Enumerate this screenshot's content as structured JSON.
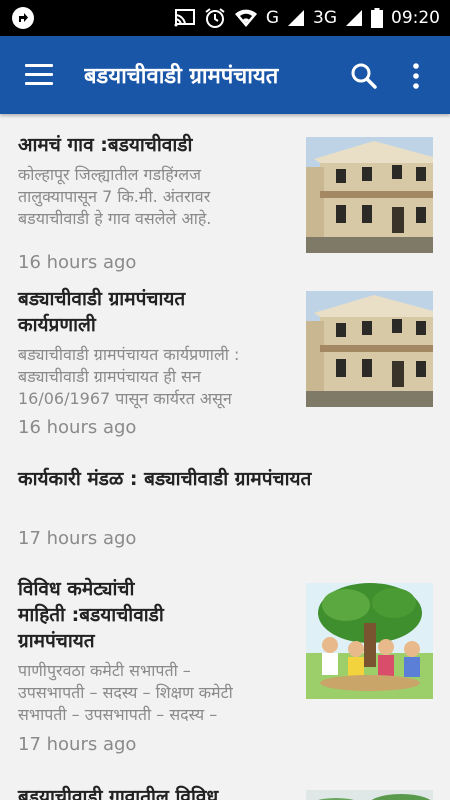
{
  "status_bar": {
    "network_label": "G",
    "network2_label": "3G",
    "time": "09:20",
    "icons": [
      "app-notification-icon",
      "cast-icon",
      "alarm-icon",
      "wifi-icon",
      "signal-icon",
      "signal-icon",
      "battery-icon"
    ]
  },
  "app_bar": {
    "title": "बडयाचीवाडी ग्रामपंचायत",
    "icons": [
      "menu-icon",
      "search-icon",
      "more-vert-icon"
    ],
    "color": "#1a56a8"
  },
  "posts": [
    {
      "title": "आमचं गाव :बडयाचीवाडी",
      "excerpt_lines": [
        "कोल्हापूर जिल्ह्यातील गडहिंग्लज",
        "तालुक्यापासून 7  कि.मी. अंतरावर",
        "बडयाचीवाडी हे गाव वसलेले आहे."
      ],
      "time": "16 hours ago",
      "thumbnail": "building-photo"
    },
    {
      "title_lines": [
        "बड्याचीवाडी ग्रामपंचायत",
        "कार्यप्रणाली"
      ],
      "excerpt_lines": [
        "बड्याचीवाडी ग्रामपंचायत कार्यप्रणाली :",
        "बड्याचीवाडी ग्रामपंचायत ही सन",
        "16/06/1967 पासून कार्यरत असून"
      ],
      "time": "16 hours ago",
      "thumbnail": "building-photo"
    },
    {
      "title": "कार्यकारी मंडळ : बड्याचीवाडी ग्रामपंचायत",
      "time": "17 hours ago"
    },
    {
      "title_lines": [
        "विविध कमेट्यांची",
        "माहिती :बडयाचीवाडी",
        "ग्रामपंचायत"
      ],
      "excerpt_lines": [
        "पाणीपुरवठा कमेटी सभापती –",
        "उपसभापती – सदस्य –   शिक्षण कमेटी",
        "सभापती – उपसभापती – सदस्य –"
      ],
      "time": "17 hours ago",
      "thumbnail": "village-meeting-illustration"
    },
    {
      "title": "बडयाचीवाडी  गावातील विविध",
      "thumbnail": "outdoor-photo"
    }
  ]
}
